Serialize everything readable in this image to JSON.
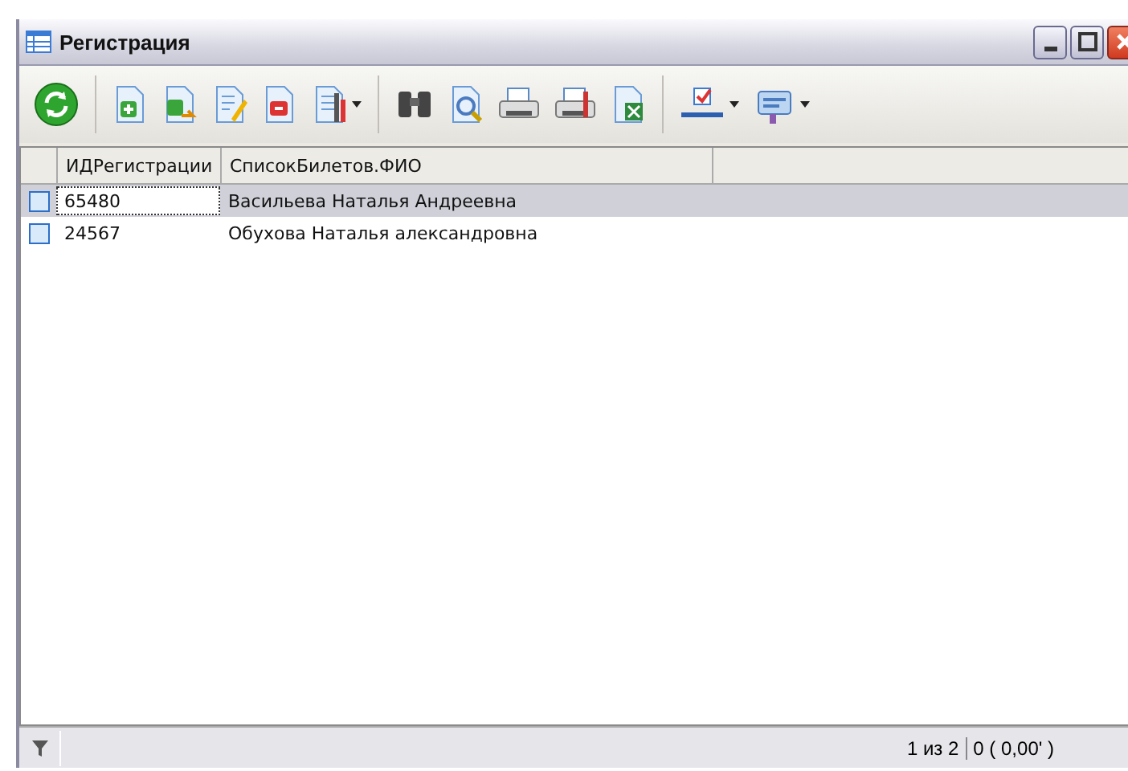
{
  "window": {
    "title": "Регистрация"
  },
  "table": {
    "columns": [
      "ИДРегистрации",
      "СписокБилетов.ФИО"
    ],
    "rows": [
      {
        "checked": false,
        "selected": true,
        "cells": [
          "65480",
          "Васильева Наталья Андреевна"
        ]
      },
      {
        "checked": false,
        "selected": false,
        "cells": [
          "24567",
          "Обухова Наталья александровна"
        ]
      }
    ]
  },
  "status_bar": {
    "position": "1 из 2",
    "summary": "0 ( 0,00' )"
  }
}
